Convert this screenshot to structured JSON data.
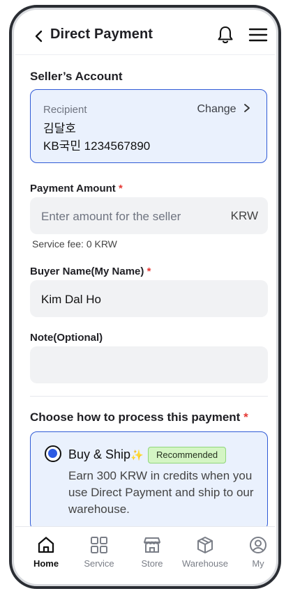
{
  "header": {
    "title": "Direct Payment"
  },
  "seller_section": {
    "title": "Seller’s Account",
    "recipient_label": "Recipient",
    "change_label": "Change",
    "recipient_name": "김달호",
    "recipient_account": "KB국민 1234567890"
  },
  "payment_amount": {
    "label": "Payment Amount",
    "required_mark": "*",
    "placeholder": "Enter amount for the seller",
    "currency": "KRW",
    "service_fee": "Service fee: 0 KRW"
  },
  "buyer_name": {
    "label": "Buyer Name(My Name)",
    "required_mark": "*",
    "value": "Kim Dal Ho"
  },
  "note": {
    "label": "Note(Optional)",
    "value": ""
  },
  "process_section": {
    "title": "Choose how to process this payment",
    "required_mark": "*",
    "option": {
      "title": "Buy & Ship",
      "sparkle": "✨",
      "badge": "Recommended",
      "description": "Earn 300 KRW in credits when you use Direct Payment and ship to our warehouse.",
      "selected": true
    }
  },
  "bottom_nav": {
    "items": [
      {
        "label": "Home",
        "icon": "home-icon",
        "active": true
      },
      {
        "label": "Service",
        "icon": "grid-icon",
        "active": false
      },
      {
        "label": "Store",
        "icon": "store-icon",
        "active": false
      },
      {
        "label": "Warehouse",
        "icon": "box-icon",
        "active": false
      },
      {
        "label": "My",
        "icon": "user-icon",
        "active": false
      }
    ]
  },
  "colors": {
    "accent": "#2f5ad6",
    "accent_bg": "#eaf1fd",
    "required": "#e53935",
    "badge_bg": "#d4f5c4"
  }
}
